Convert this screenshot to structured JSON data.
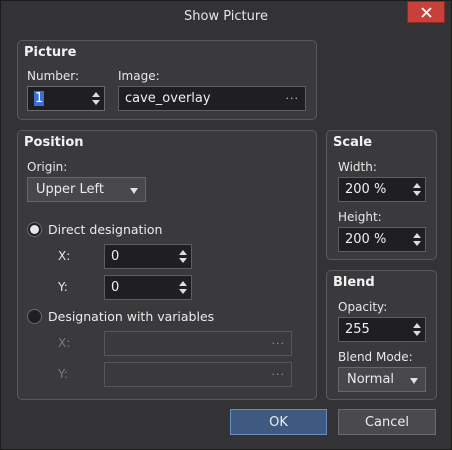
{
  "window": {
    "title": "Show Picture"
  },
  "picture": {
    "title": "Picture",
    "number_label": "Number:",
    "number_value": "1",
    "image_label": "Image:",
    "image_value": "cave_overlay",
    "image_browse": "···"
  },
  "position": {
    "title": "Position",
    "origin_label": "Origin:",
    "origin_value": "Upper Left",
    "direct_label": "Direct designation",
    "direct_selected": true,
    "x_label": "X:",
    "x_value": "0",
    "y_label": "Y:",
    "y_value": "0",
    "variables_label": "Designation with variables",
    "variables_selected": false,
    "var_x_label": "X:",
    "var_y_label": "Y:",
    "var_browse": "···"
  },
  "scale": {
    "title": "Scale",
    "width_label": "Width:",
    "width_value": "200 %",
    "height_label": "Height:",
    "height_value": "200 %"
  },
  "blend": {
    "title": "Blend",
    "opacity_label": "Opacity:",
    "opacity_value": "255",
    "mode_label": "Blend Mode:",
    "mode_value": "Normal"
  },
  "buttons": {
    "ok": "OK",
    "cancel": "Cancel"
  },
  "colors": {
    "accent": "#3f5a80",
    "close": "#c7413a",
    "selection": "#3b6fd1"
  }
}
